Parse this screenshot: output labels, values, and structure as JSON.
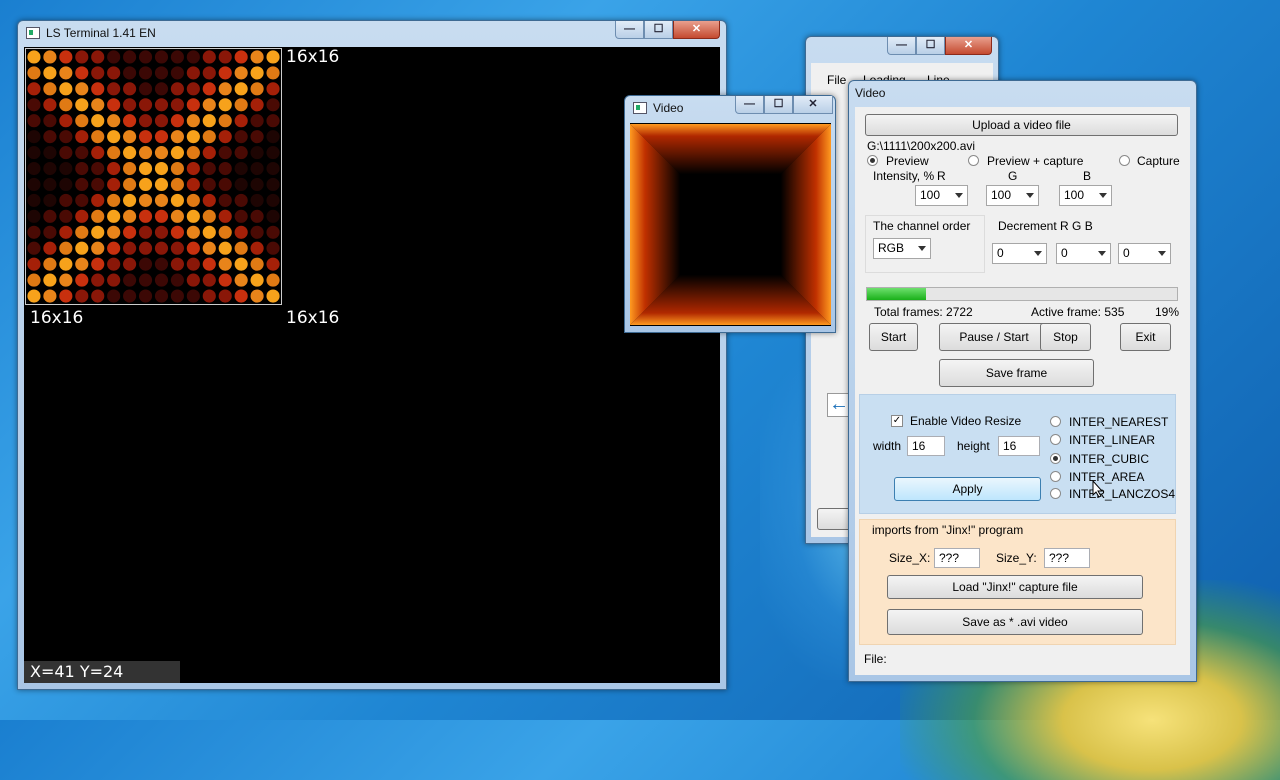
{
  "ls_terminal": {
    "title": "LS Terminal 1.41 EN",
    "labels": [
      "16x16",
      "16x16",
      "16x16"
    ],
    "coords": "X=41  Y=24"
  },
  "video_preview": {
    "title": "Video"
  },
  "back_window": {
    "menu_file": "File",
    "menu_2": "Loading",
    "menu_3": "Line"
  },
  "video": {
    "title": "Video",
    "upload_label": "Upload a video file",
    "file_path": "G:\\1111\\200x200.avi",
    "modes": [
      "Preview",
      "Preview + capture",
      "Capture"
    ],
    "mode_selected": 0,
    "intensity_label": "Intensity, %",
    "channel_letters": [
      "R",
      "G",
      "B"
    ],
    "intensity_values": [
      "100",
      "100",
      "100"
    ],
    "channel_order_label": "The channel order",
    "channel_order_value": "RGB",
    "decrement_label": "Decrement  R  G  B",
    "decrement_values": [
      "0",
      "0",
      "0"
    ],
    "progress": 0.19,
    "total_frames": "Total frames: 2722",
    "active_frame": "Active frame: 535",
    "percent": "19%",
    "start": "Start",
    "pause": "Pause / Start",
    "stop": "Stop",
    "exit": "Exit",
    "save_frame": "Save frame",
    "enable_resize": "Enable Video Resize",
    "width_label": "width",
    "width_value": "16",
    "height_label": "height",
    "height_value": "16",
    "apply": "Apply",
    "interp": [
      "INTER_NEAREST",
      "INTER_LINEAR",
      "INTER_CUBIC",
      "INTER_AREA",
      "INTER_LANCZOS4"
    ],
    "interp_selected": 2,
    "jinx_group": "imports from \"Jinx!\" program",
    "size_x_label": "Size_X:",
    "size_x_value": "???",
    "size_y_label": "Size_Y:",
    "size_y_value": "???",
    "load_jinx": "Load \"Jinx!\" capture file",
    "save_avi": "Save as * .avi video",
    "file_label": "File:"
  }
}
